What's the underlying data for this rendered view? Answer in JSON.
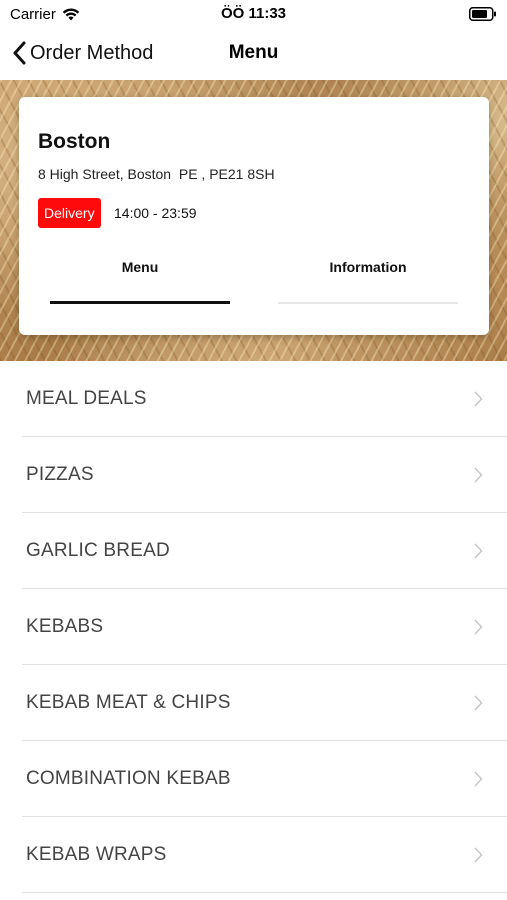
{
  "status_bar": {
    "carrier": "Carrier",
    "time": "ÖÖ 11:33"
  },
  "nav": {
    "back_label": "Order Method",
    "title": "Menu"
  },
  "store": {
    "name": "Boston",
    "address": "8 High Street, Boston  PE , PE21 8SH",
    "badge": "Delivery",
    "hours": "14:00 - 23:59",
    "tabs": [
      {
        "label": "Menu",
        "selected": true
      },
      {
        "label": "Information",
        "selected": false
      }
    ]
  },
  "menu_categories": [
    "MEAL DEALS",
    "PIZZAS",
    "GARLIC BREAD",
    "KEBABS",
    "KEBAB MEAT & CHIPS",
    "COMBINATION KEBAB",
    "KEBAB WRAPS"
  ],
  "colors": {
    "badge": "#ff0a0a",
    "selected_tab_underline": "#111111",
    "text_muted": "#444444"
  }
}
